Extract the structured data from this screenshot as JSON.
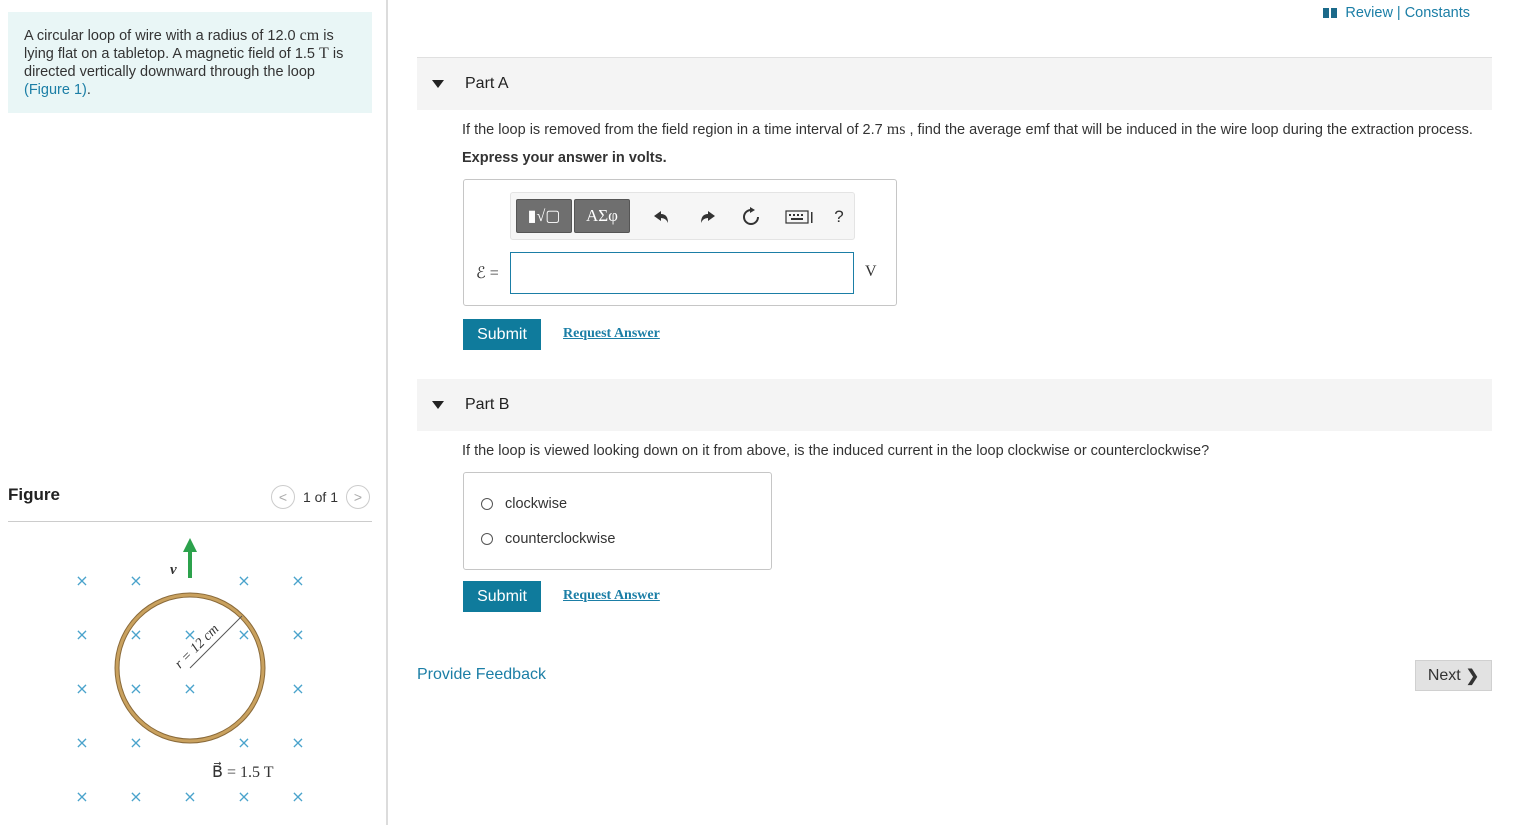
{
  "problem": {
    "text_1": "A circular loop of wire with a radius of 12.0 ",
    "unit_cm": "cm",
    "text_2": " is lying flat on a tabletop. A magnetic field of 1.5 ",
    "unit_T": "T",
    "text_3": " is directed vertically downward through the loop ",
    "figure_link": "(Figure 1)",
    "text_4": "."
  },
  "figure": {
    "title": "Figure",
    "pager": {
      "prev": "<",
      "label": "1 of 1",
      "next": ">"
    },
    "velocity_label": "v⃗",
    "radius_label": "r = 12 cm",
    "field_label": "B⃗ = 1.5 T",
    "cross_symbol": "×",
    "colors": {
      "field_x": "#4aa3cc",
      "loop": "#c9a15e",
      "arrow": "#2ca24c"
    }
  },
  "top_links": {
    "review": "Review",
    "separator": " | ",
    "constants": "Constants"
  },
  "partA": {
    "label": "Part A",
    "question_1": "If the loop is removed from the field region in a time interval of 2.7 ",
    "question_unit": "ms",
    "question_2": " , find the average emf that will be induced in the wire loop during the extraction process.",
    "instruction": "Express your answer in volts.",
    "toolbar": {
      "templates": "▮√▢",
      "symbols": "ΑΣφ",
      "undo_icon": "undo-icon",
      "redo_icon": "redo-icon",
      "reset_icon": "reset-icon",
      "keyboard_icon": "keyboard-icon",
      "help": "?"
    },
    "input_label": "ℰ =",
    "input_value": "",
    "unit": "V",
    "submit": "Submit",
    "request": "Request Answer"
  },
  "partB": {
    "label": "Part B",
    "question": "If the loop is viewed looking down on it from above, is the induced current in the loop clockwise or counterclockwise?",
    "options": [
      "clockwise",
      "counterclockwise"
    ],
    "submit": "Submit",
    "request": "Request Answer"
  },
  "footer": {
    "feedback": "Provide Feedback",
    "next": "Next",
    "next_chevron": "❯"
  }
}
